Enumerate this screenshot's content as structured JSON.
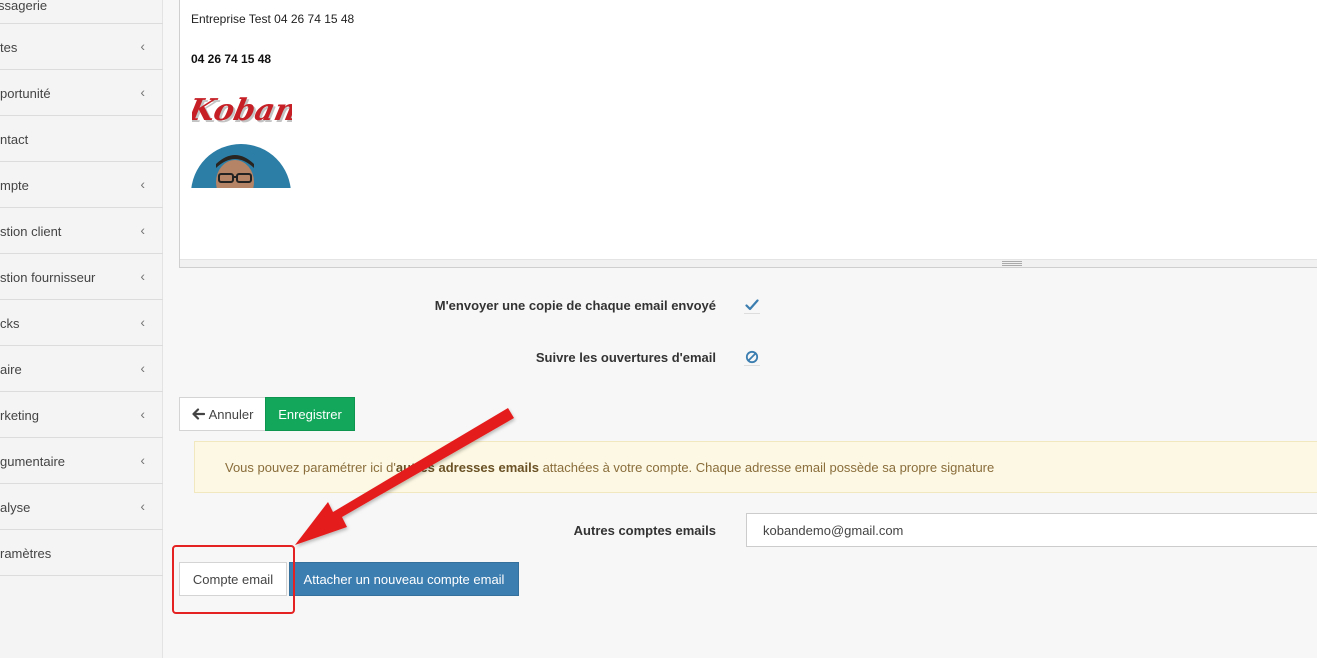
{
  "sidebar": {
    "items": [
      {
        "label": "Messagerie",
        "chevron": false
      },
      {
        "label": "Ventes",
        "chevron": true
      },
      {
        "label": "Opportunité",
        "chevron": true
      },
      {
        "label": "Contact",
        "chevron": false
      },
      {
        "label": "Compte",
        "chevron": true
      },
      {
        "label": "Gestion client",
        "chevron": true
      },
      {
        "label": "Gestion fournisseur",
        "chevron": true
      },
      {
        "label": "Stocks",
        "chevron": true
      },
      {
        "label": "Affaire",
        "chevron": true
      },
      {
        "label": "Marketing",
        "chevron": true
      },
      {
        "label": "Argumentaire",
        "chevron": true
      },
      {
        "label": "Analyse",
        "chevron": true
      },
      {
        "label": "Paramètres",
        "chevron": false
      }
    ],
    "visible_labels": [
      "ssagerie",
      "tes",
      "portunité",
      "ntact",
      "mpte",
      "stion client",
      "stion fournisseur",
      "cks",
      "aire",
      "rketing",
      "gumentaire",
      "alyse",
      "ramètres"
    ],
    "chevron_glyph": "‹"
  },
  "editor": {
    "signature_line": "Entreprise Test 04 26 74 15 48",
    "signature_phone": "04 26 74 15 48",
    "logo_text": "Koban"
  },
  "form": {
    "copy_label": "M'envoyer une copie de chaque email envoyé",
    "track_label": "Suivre les ouvertures d'email",
    "other_accounts_label": "Autres comptes emails",
    "other_accounts_value": "kobandemo@gmail.com"
  },
  "buttons": {
    "cancel": "Annuler",
    "save": "Enregistrer",
    "email_account": "Compte email",
    "attach_account": "Attacher un nouveau compte email"
  },
  "alert": {
    "before": "Vous pouvez paramétrer ici d'",
    "bold": "autres adresses emails",
    "after": " attachées à votre compte. Chaque adresse email possède sa propre signature"
  },
  "colors": {
    "success": "#12a75a",
    "primary": "#3c7eb0",
    "highlight": "#e52222",
    "alert_bg": "#fcf8e3"
  }
}
